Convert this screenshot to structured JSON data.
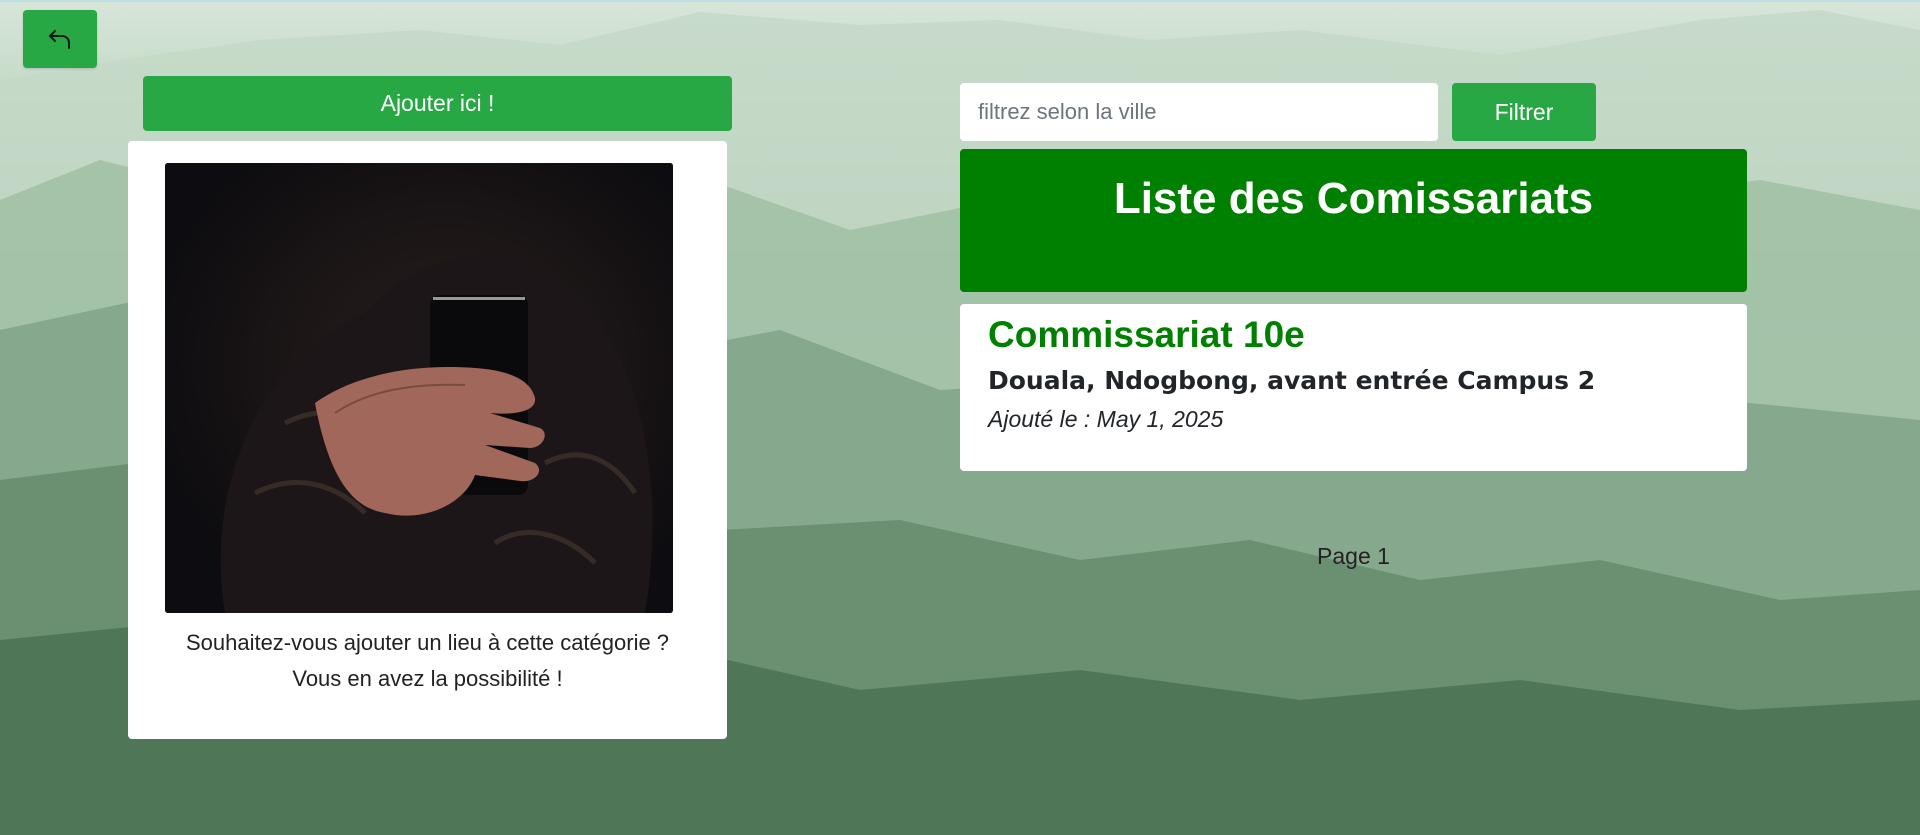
{
  "toolbar": {
    "back_icon": "reply-arrow-icon",
    "add_label": "Ajouter ici !"
  },
  "promo": {
    "image_icon": "person-holding-phone-photo",
    "text_line1": "Souhaitez-vous ajouter un lieu à cette catégorie ?",
    "text_line2": "Vous en avez la possibilité !"
  },
  "filter": {
    "placeholder": "filtrez selon la ville",
    "button_label": "Filtrer"
  },
  "list": {
    "title": "Liste des Comissariats",
    "items": [
      {
        "name": "Commissariat 10e",
        "address": "Douala, Ndogbong, avant entrée Campus 2",
        "added": "Ajouté le : May 1, 2025"
      }
    ]
  },
  "pagination": {
    "label": "Page 1"
  },
  "colors": {
    "button_green": "#28a745",
    "header_green": "#008000",
    "title_green": "#008000"
  }
}
